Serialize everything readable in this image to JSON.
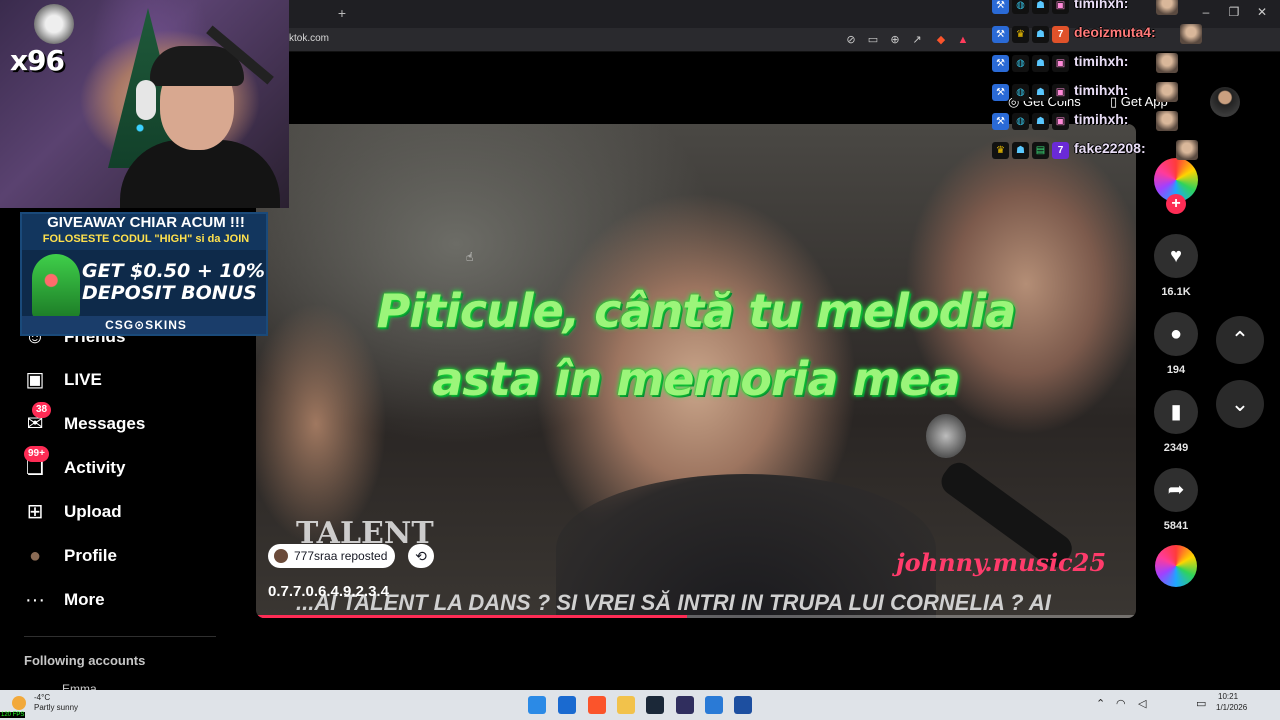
{
  "browser": {
    "new_tab": "+",
    "url": "ktok.com",
    "win_min": "–",
    "win_max": "❐",
    "win_close": "✕"
  },
  "sidebar": {
    "items": [
      {
        "label": "Friends",
        "icon": "friends-icon",
        "glyph": "☺"
      },
      {
        "label": "LIVE",
        "icon": "live-icon",
        "glyph": "▣"
      },
      {
        "label": "Messages",
        "icon": "messages-icon",
        "glyph": "✉",
        "badge": "38"
      },
      {
        "label": "Activity",
        "icon": "activity-icon",
        "glyph": "❏",
        "badge": "99+"
      },
      {
        "label": "Upload",
        "icon": "upload-icon",
        "glyph": "⊞"
      },
      {
        "label": "Profile",
        "icon": "profile-icon",
        "glyph": "●"
      },
      {
        "label": "More",
        "icon": "more-icon",
        "glyph": "···"
      }
    ],
    "following_title": "Following accounts",
    "following_user": "Emma"
  },
  "header": {
    "get_coins": "Get Coins",
    "get_app": "Get App"
  },
  "video": {
    "caption_line1": "Piticule, cântă tu melodia",
    "caption_line2": "asta în memoria mea",
    "overlay_talent": "TALENT",
    "watermark": "johnny.music25",
    "ticker": "...AI TALENT LA DANS ? SI VREI SĂ INTRI IN TRUPA LUI CORNELIA ? AI",
    "reposted_by": "777sraa reposted",
    "title": "0.7.7.0.6.4.9.2.3.4",
    "progress_fraction": 0.49,
    "accent_color": "#fe2c55"
  },
  "actions": {
    "likes": "16.1K",
    "comments": "194",
    "saves": "2349",
    "shares": "5841"
  },
  "stream": {
    "webcam_count": "x96",
    "promo_line1": "GIVEAWAY CHIAR ACUM !!!",
    "promo_line2": "FOLOSESTE CODUL \"HIGH\" si da JOIN",
    "promo_big1": "GET $0.50 + 10%",
    "promo_big2": "DEPOSIT BONUS",
    "promo_brand": "CSG⊙SKINS",
    "chat": [
      {
        "name": "timihxh:"
      },
      {
        "name": "deoizmuta4:"
      },
      {
        "name": "timihxh:"
      },
      {
        "name": "timihxh:"
      },
      {
        "name": "timihxh:"
      },
      {
        "name": "fake22208:"
      }
    ]
  },
  "taskbar": {
    "temp": "-4°C",
    "weather": "Partly sunny",
    "time": "10:21",
    "date": "1/1/2026",
    "fps": "120 FPS"
  }
}
